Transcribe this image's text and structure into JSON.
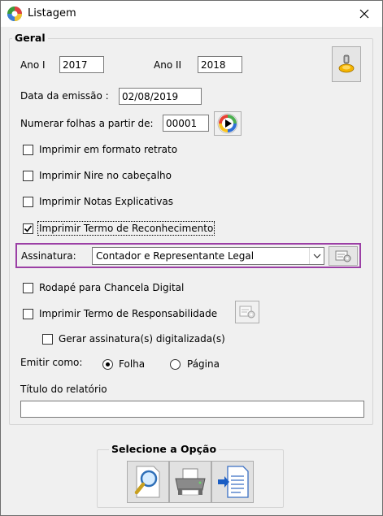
{
  "window": {
    "title": "Listagem"
  },
  "geral": {
    "legend": "Geral",
    "ano_i_label": "Ano I",
    "ano_i_value": "2017",
    "ano_ii_label": "Ano II",
    "ano_ii_value": "2018",
    "data_emissao_label": "Data da emissão :",
    "data_emissao_value": "02/08/2019",
    "numerar_label": "Numerar folhas a partir de:",
    "numerar_value": "00001",
    "options": [
      {
        "label": "Imprimir em formato retrato",
        "checked": false
      },
      {
        "label": "Imprimir Nire no cabeçalho",
        "checked": false
      },
      {
        "label": "Imprimir Notas Explicativas",
        "checked": false
      },
      {
        "label": "Imprimir Termo de Reconhecimento",
        "checked": true
      }
    ],
    "assinatura_label": "Assinatura:",
    "assinatura_value": "Contador e Representante Legal",
    "rodape_label": "Rodapé para Chancela Digital",
    "termo_resp_label": "Imprimir Termo de Responsabilidade",
    "gerar_label": "Gerar assinatura(s) digitalizada(s)",
    "emitir_label": "Emitir como:",
    "emitir_options": [
      "Folha",
      "Página"
    ],
    "emitir_selected": "Folha",
    "titulo_label": "Título do relatório",
    "titulo_value": ""
  },
  "opcao": {
    "legend": "Selecione a Opção"
  },
  "colors": {
    "highlight": "#9b3fa5"
  }
}
